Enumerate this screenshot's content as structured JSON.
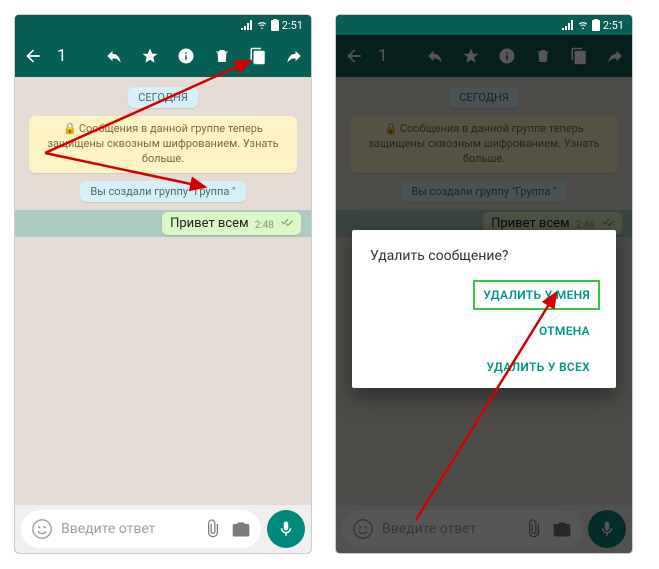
{
  "status": {
    "time": "2:51"
  },
  "appbar": {
    "count": "1"
  },
  "chat": {
    "date": "СЕГОДНЯ",
    "encryption": "Сообщения в данной группе теперь защищены сквозным шифрованием. Узнать больше.",
    "system_msg": "Вы создали группу \"Группа \"",
    "message": {
      "text": "Привет всем",
      "time": "2:48"
    }
  },
  "input": {
    "placeholder": "Введите ответ"
  },
  "dialog": {
    "title": "Удалить сообщение?",
    "delete_for_me": "УДАЛИТЬ У МЕНЯ",
    "cancel": "ОТМЕНА",
    "delete_for_all": "УДАЛИТЬ У ВСЕХ"
  }
}
